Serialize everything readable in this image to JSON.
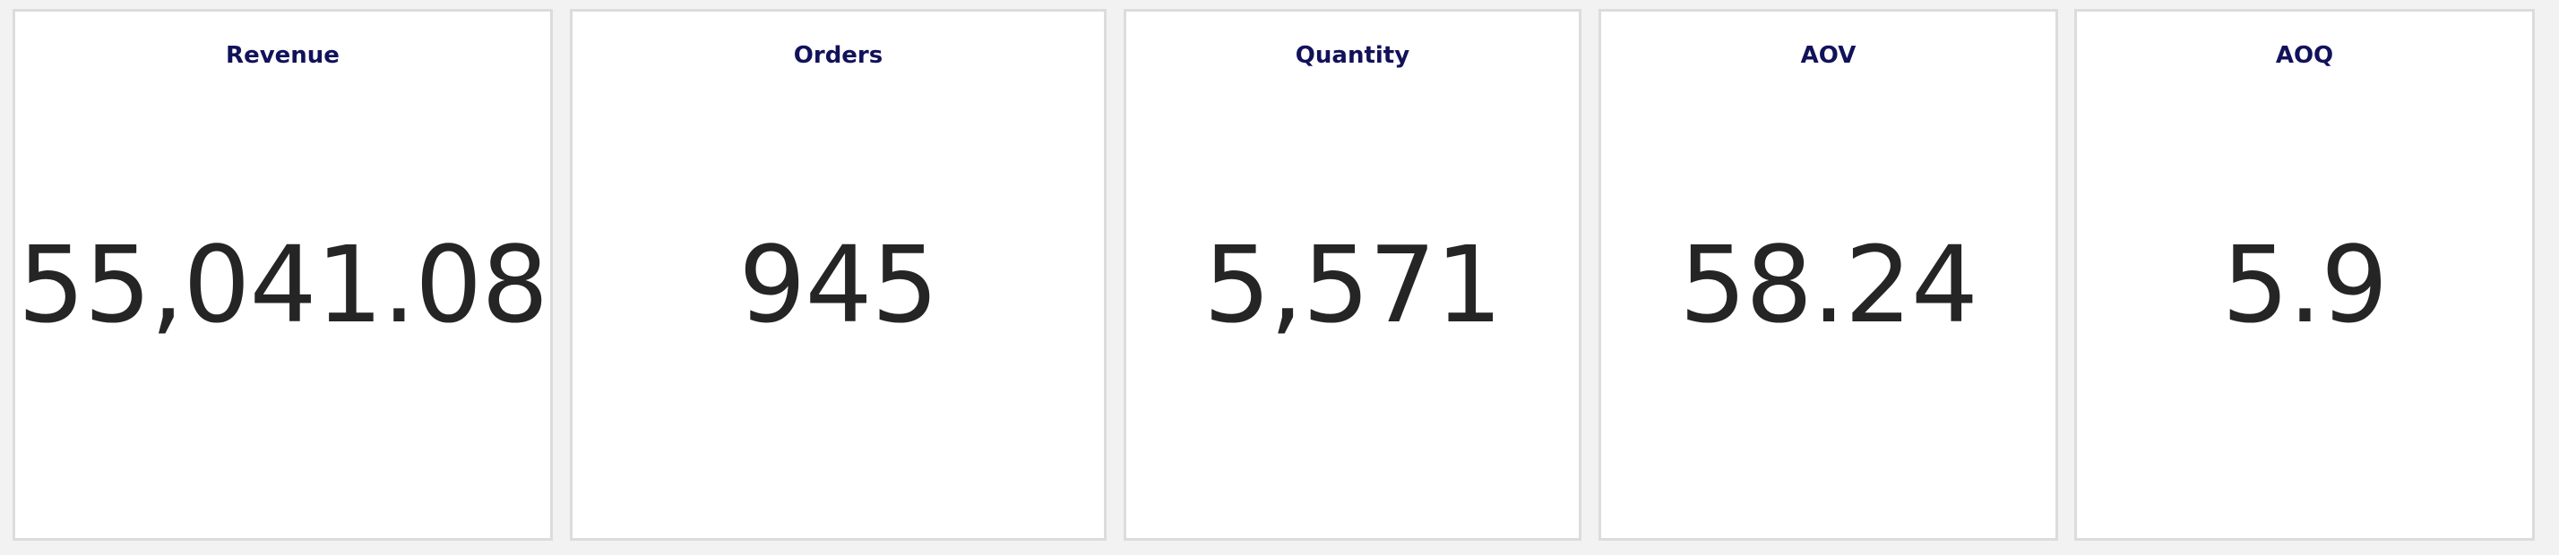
{
  "colors": {
    "page_background": "#f2f2f2",
    "card_background": "#ffffff",
    "card_border": "#dcdcdc",
    "title_color": "#12125a",
    "value_color": "#252525"
  },
  "kpis": [
    {
      "title": "Revenue",
      "value": "55,041.08"
    },
    {
      "title": "Orders",
      "value": "945"
    },
    {
      "title": "Quantity",
      "value": "5,571"
    },
    {
      "title": "AOV",
      "value": "58.24"
    },
    {
      "title": "AOQ",
      "value": "5.9"
    }
  ]
}
